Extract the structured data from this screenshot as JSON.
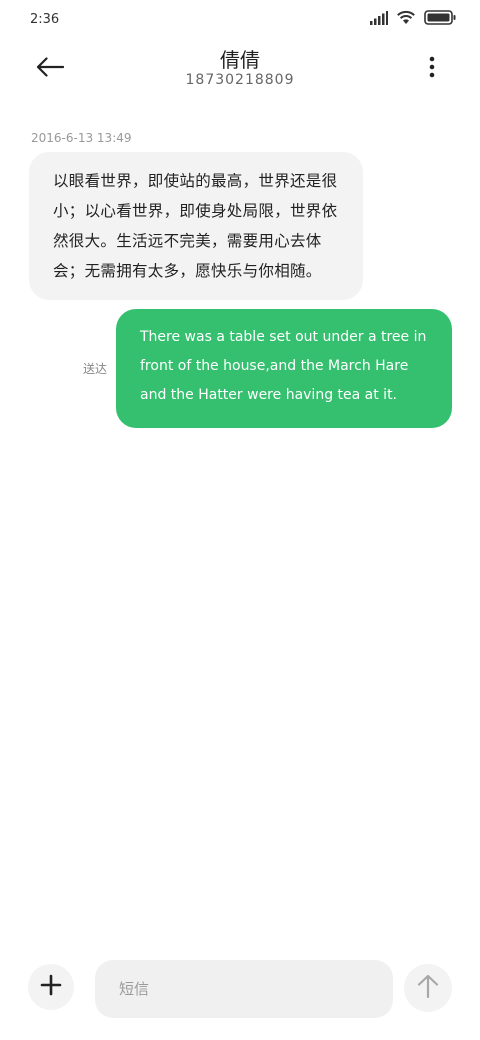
{
  "status_bar": {
    "time": "2:36",
    "icons": [
      "signal-icon",
      "wifi-icon",
      "battery-icon"
    ]
  },
  "header": {
    "contact_name": "倩倩",
    "contact_number": "18730218809",
    "back_icon": "arrow-left-icon",
    "more_icon": "more-vertical-icon"
  },
  "conversation": {
    "timestamp": "2016-6-13 13:49",
    "received_message": "以眼看世界，即使站的最高，世界还是很小；以心看世界，即使身处局限，世界依然很大。生活远不完美，需要用心去体会；无需拥有太多，愿快乐与你相随。",
    "sent_message": "There was a table set out under a tree in front of the house,and the March Hare and the Hatter were having tea at it.",
    "sent_status": "送达"
  },
  "composer": {
    "placeholder": "短信",
    "value": "",
    "add_icon": "plus-icon",
    "send_icon": "arrow-up-icon"
  },
  "colors": {
    "sent_bubble": "#34c06e",
    "received_bubble": "#f3f3f3",
    "input_background": "#f0f0f0"
  }
}
